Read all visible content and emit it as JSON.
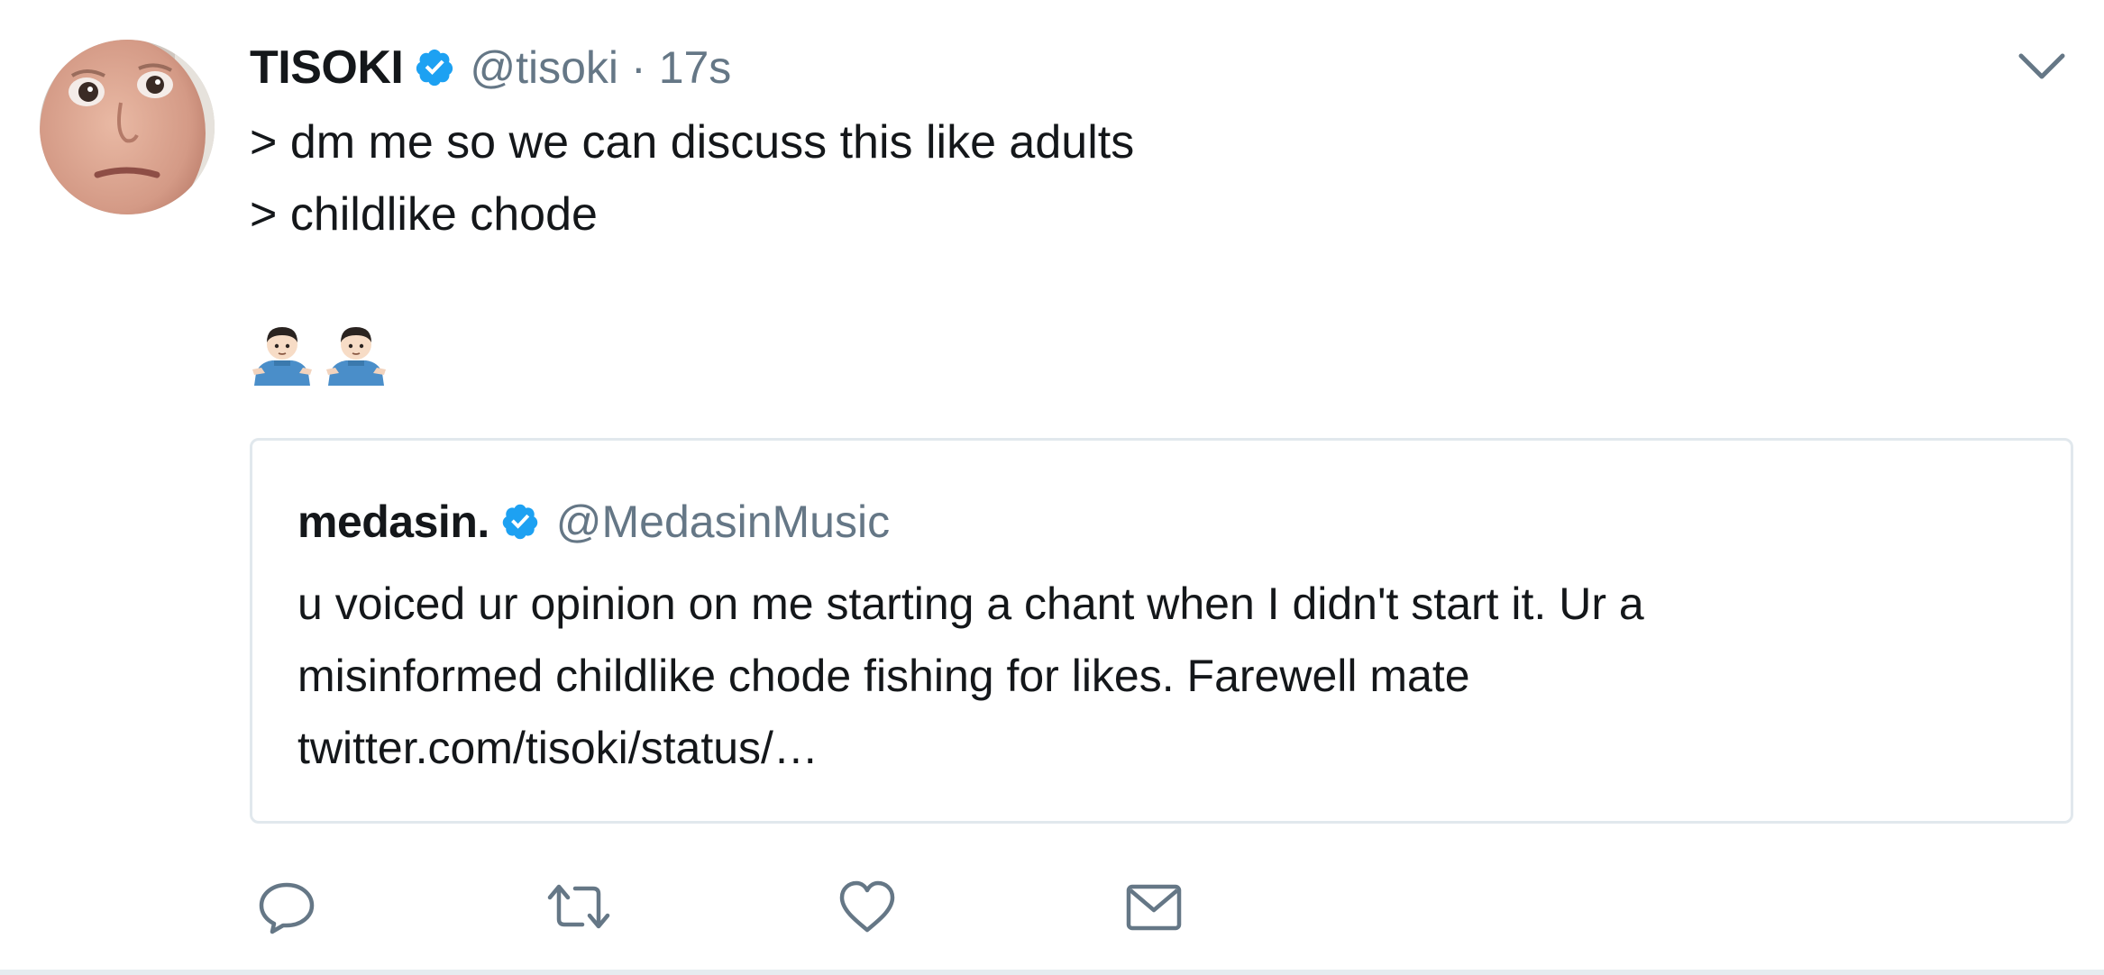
{
  "tweet": {
    "author": {
      "display_name": "TISOKI",
      "handle": "@tisoki",
      "verified": true,
      "avatar_icon": "avatar-photo"
    },
    "separator": "·",
    "timestamp": "17s",
    "text_lines": [
      "> dm me so we can discuss this like adults",
      "> childlike chode"
    ],
    "emojis": [
      "man-shrugging-emoji",
      "man-shrugging-emoji"
    ],
    "menu_icon": "chevron-down-icon",
    "quoted_tweet": {
      "display_name": "medasin.",
      "handle": "@MedasinMusic",
      "verified": true,
      "text_lines": [
        "u voiced ur opinion on me starting a chant when I didn't start it. Ur a",
        "misinformed childlike chode fishing for likes. Farewell mate",
        "twitter.com/tisoki/status/…"
      ]
    },
    "actions": [
      {
        "name": "reply",
        "icon": "reply-icon"
      },
      {
        "name": "retweet",
        "icon": "retweet-icon"
      },
      {
        "name": "like",
        "icon": "heart-icon"
      },
      {
        "name": "direct-message",
        "icon": "envelope-icon"
      }
    ]
  },
  "colors": {
    "text_primary": "#14171a",
    "text_secondary": "#657786",
    "verified_blue": "#1da1f2",
    "border": "#e1e8ed",
    "action_icon": "#657786"
  }
}
